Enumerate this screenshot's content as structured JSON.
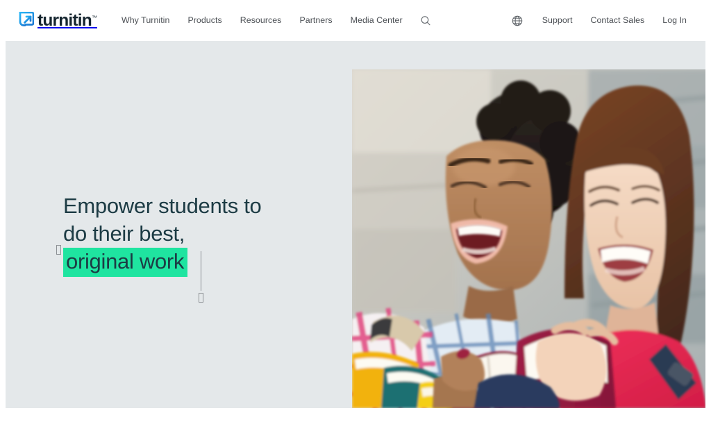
{
  "header": {
    "logo": {
      "icon": "turnitin-arrow-logo-icon",
      "wordmark": "turnitin",
      "trademark": "™"
    },
    "primary_nav": [
      {
        "label": "Why Turnitin",
        "name": "nav-link-why-turnitin"
      },
      {
        "label": "Products",
        "name": "nav-link-products"
      },
      {
        "label": "Resources",
        "name": "nav-link-resources"
      },
      {
        "label": "Partners",
        "name": "nav-link-partners"
      },
      {
        "label": "Media Center",
        "name": "nav-link-media-center"
      }
    ],
    "search": {
      "icon": "search-icon",
      "label": "Search"
    },
    "language": {
      "icon": "globe-icon",
      "label": "Language"
    },
    "secondary_nav": [
      {
        "label": "Support",
        "name": "nav-link-support"
      },
      {
        "label": "Contact Sales",
        "name": "nav-link-contact-sales"
      },
      {
        "label": "Log In",
        "name": "nav-link-log-in"
      }
    ]
  },
  "hero": {
    "headline_line1": "Empower students to",
    "headline_line2": "do their best,",
    "headline_highlight": "original work",
    "image_alt": "Two laughing students reading books while holding textbooks and backpacks"
  },
  "colors": {
    "brand_navy": "#15252f",
    "logo_blue": "#2196f3",
    "headline_navy": "#1c3b44",
    "highlight_green": "#1fe4a0",
    "hero_background": "#e4e8ea",
    "nav_text": "#4b4f54",
    "page_background": "#ffffff",
    "handle_gray": "#8c9094"
  }
}
